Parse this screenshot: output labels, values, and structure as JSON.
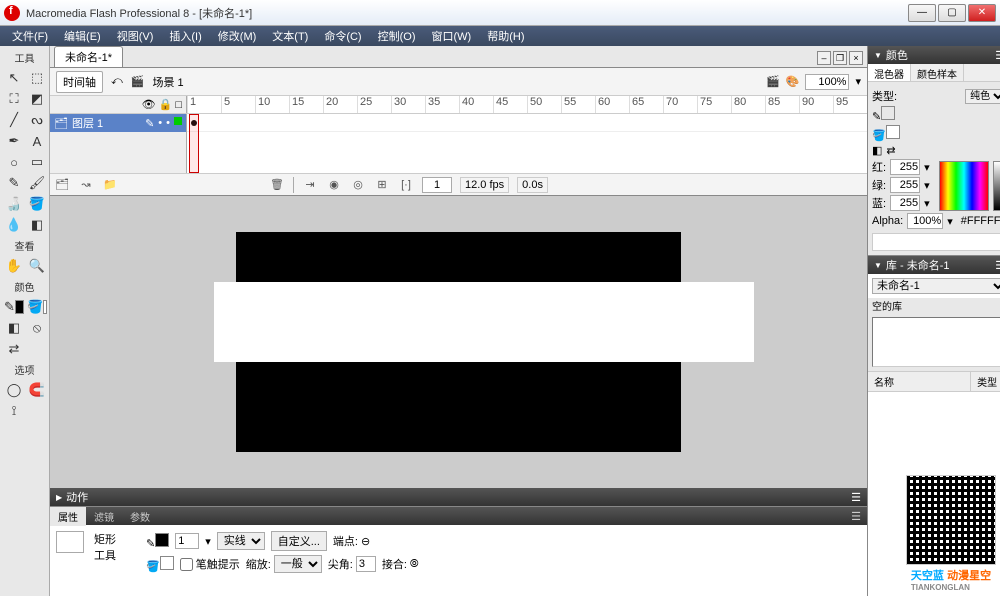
{
  "app": {
    "title": "Macromedia Flash Professional 8 - [未命名-1*]"
  },
  "menu": [
    "文件(F)",
    "编辑(E)",
    "视图(V)",
    "插入(I)",
    "修改(M)",
    "文本(T)",
    "命令(C)",
    "控制(O)",
    "窗口(W)",
    "帮助(H)"
  ],
  "tools": {
    "title": "工具",
    "sections": {
      "view": "查看",
      "colors": "颜色",
      "options": "选项"
    }
  },
  "doc": {
    "tab": "未命名-1*"
  },
  "scene": {
    "timeline_btn": "时间轴",
    "name": "场景 1",
    "zoom": "100%"
  },
  "timeline": {
    "layer": "图层 1",
    "ruler": [
      "1",
      "5",
      "10",
      "15",
      "20",
      "25",
      "30",
      "35",
      "40",
      "45",
      "50",
      "55",
      "60",
      "65",
      "70",
      "75",
      "80",
      "85",
      "90",
      "95"
    ],
    "frame": "1",
    "fps": "12.0 fps",
    "time": "0.0s"
  },
  "actions_panel": "动作",
  "props": {
    "tabs": [
      "属性",
      "滤镜",
      "参数"
    ],
    "tool_name": "矩形\n工具",
    "stroke_weight": "1",
    "stroke_style": "实线",
    "custom": "自定义...",
    "cap_label": "端点:",
    "hint": "笔触提示",
    "scale_label": "缩放:",
    "scale_value": "一般",
    "miter_label": "尖角:",
    "miter_value": "3",
    "join_label": "接合:"
  },
  "color_panel": {
    "title": "颜色",
    "tabs": [
      "混色器",
      "颜色样本"
    ],
    "type_label": "类型:",
    "type_value": "纯色",
    "r_label": "红:",
    "r": "255",
    "g_label": "绿:",
    "g": "255",
    "b_label": "蓝:",
    "b": "255",
    "alpha_label": "Alpha:",
    "alpha": "100%",
    "hex": "#FFFFFF"
  },
  "library": {
    "title": "库 - 未命名-1",
    "doc": "未命名-1",
    "empty": "空的库",
    "col_name": "名称",
    "col_type": "类型"
  },
  "watermark": {
    "brand": "天空蓝",
    "sub": "动漫星空",
    "en": "TIANKONGLAN"
  }
}
